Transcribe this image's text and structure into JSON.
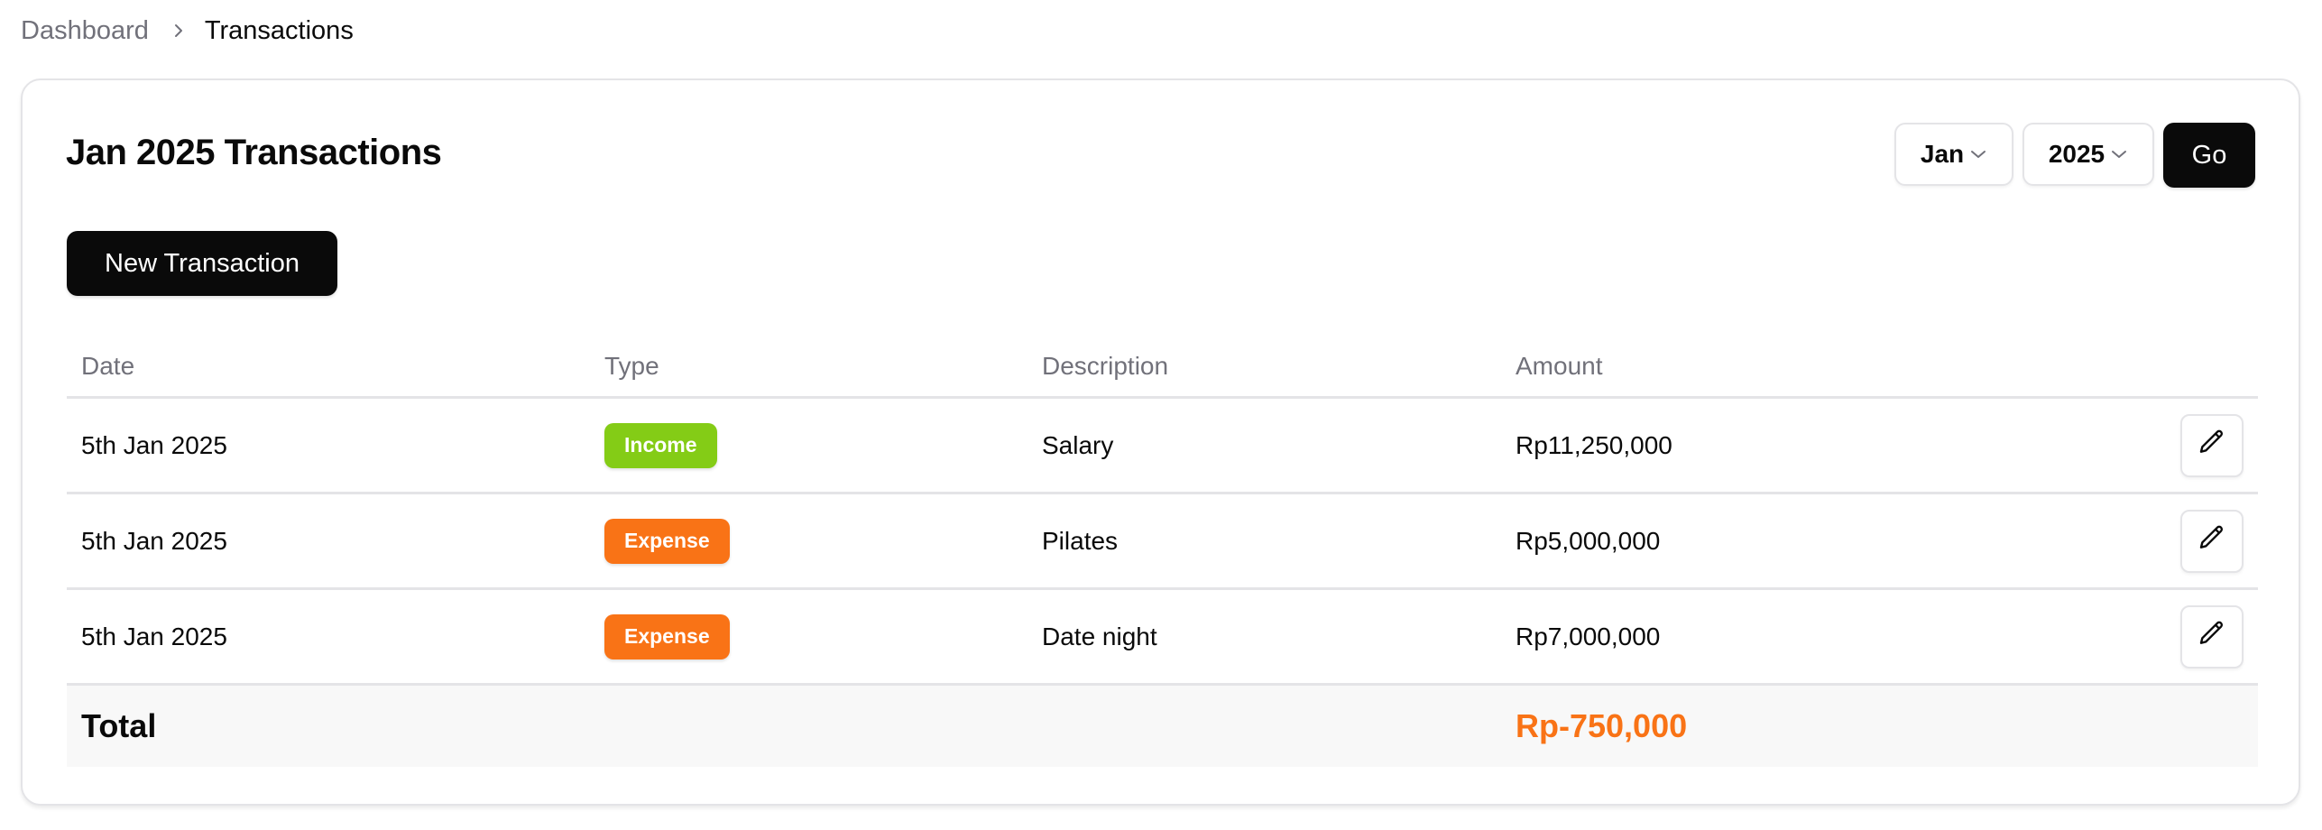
{
  "breadcrumb": {
    "items": [
      {
        "label": "Dashboard",
        "current": false
      },
      {
        "label": "Transactions",
        "current": true
      }
    ],
    "separator_icon": "chevron-right-icon"
  },
  "card": {
    "title": "Jan 2025 Transactions",
    "filters": {
      "month": {
        "selected": "Jan",
        "icon": "chevron-down-icon"
      },
      "year": {
        "selected": "2025",
        "icon": "chevron-down-icon"
      },
      "go_label": "Go"
    },
    "new_transaction_label": "New Transaction"
  },
  "table": {
    "columns": [
      "Date",
      "Type",
      "Description",
      "Amount"
    ],
    "rows": [
      {
        "date": "5th Jan 2025",
        "type": "Income",
        "description": "Salary",
        "amount": "Rp11,250,000",
        "action_icon": "pencil-icon"
      },
      {
        "date": "5th Jan 2025",
        "type": "Expense",
        "description": "Pilates",
        "amount": "Rp5,000,000",
        "action_icon": "pencil-icon"
      },
      {
        "date": "5th Jan 2025",
        "type": "Expense",
        "description": "Date night",
        "amount": "Rp7,000,000",
        "action_icon": "pencil-icon"
      }
    ],
    "footer": {
      "label": "Total",
      "value": "Rp-750,000"
    }
  },
  "colors": {
    "income": "#84cc16",
    "expense": "#f97316",
    "total_negative": "#f97316",
    "primary_button": "#0a0a0a",
    "muted_text": "#71717a"
  }
}
